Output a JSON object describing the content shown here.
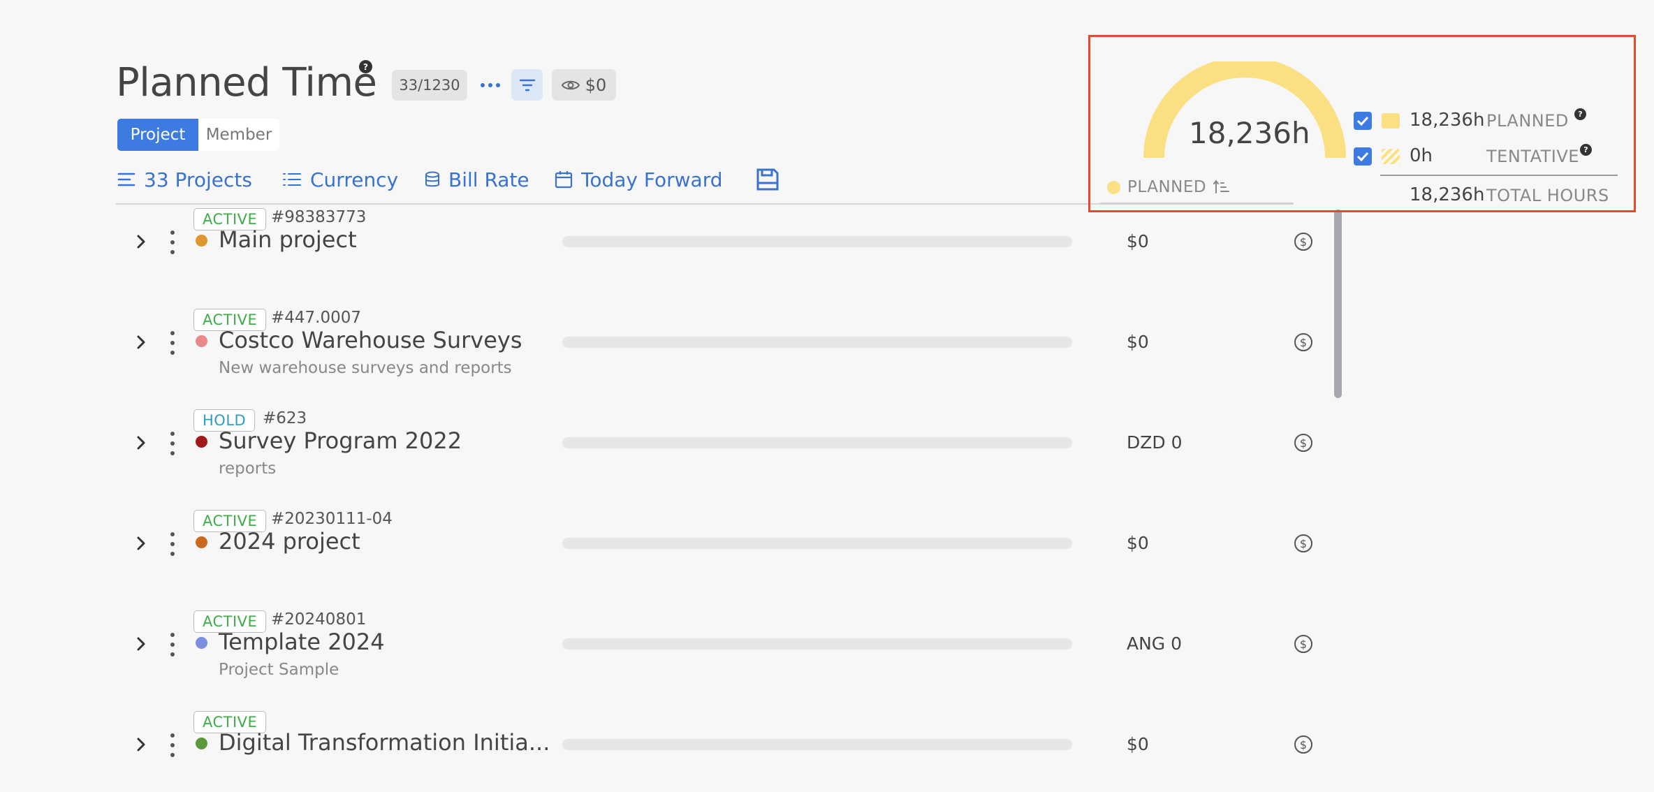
{
  "header": {
    "title": "Planned Time",
    "help_mark": "?",
    "count": "33/1230",
    "view_value": "$0"
  },
  "toggle": {
    "project_label": "Project",
    "member_label": "Member"
  },
  "toolbar": {
    "projects_label": "33 Projects",
    "currency_label": "Currency",
    "bill_rate_label": "Bill Rate",
    "date_range_label": "Today Forward"
  },
  "projects": [
    {
      "status": "ACTIVE",
      "status_kind": "active",
      "id": "#98383773",
      "name": "Main project",
      "description": "",
      "color": "#e0962e",
      "amount": "$0"
    },
    {
      "status": "ACTIVE",
      "status_kind": "active",
      "id": "#447.0007",
      "name": "Costco Warehouse Surveys",
      "description": "New warehouse surveys and reports",
      "color": "#e88a8a",
      "amount": "$0"
    },
    {
      "status": "HOLD",
      "status_kind": "hold",
      "id": "#623",
      "name": "Survey Program 2022",
      "description": "reports",
      "color": "#a01a1a",
      "amount": "DZD 0"
    },
    {
      "status": "ACTIVE",
      "status_kind": "active",
      "id": "#20230111-04",
      "name": "2024 project",
      "description": "",
      "color": "#c96a1e",
      "amount": "$0"
    },
    {
      "status": "ACTIVE",
      "status_kind": "active",
      "id": "#20240801",
      "name": "Template 2024",
      "description": "Project Sample",
      "color": "#7b8ee0",
      "amount": "ANG 0"
    },
    {
      "status": "ACTIVE",
      "status_kind": "active",
      "id": "",
      "name": "Digital Transformation Initia...",
      "description": "",
      "color": "#5a9a3a",
      "amount": "$0"
    }
  ],
  "summary": {
    "gauge_value": "18,236h",
    "gauge_fraction": 1.0,
    "gauge_color": "#fbe083",
    "gauge_legend": "PLANNED",
    "planned_value": "18,236h",
    "planned_label": "PLANNED",
    "tentative_value": "0h",
    "tentative_label": "TENTATIVE",
    "total_value": "18,236h",
    "total_label": "TOTAL HOURS"
  }
}
